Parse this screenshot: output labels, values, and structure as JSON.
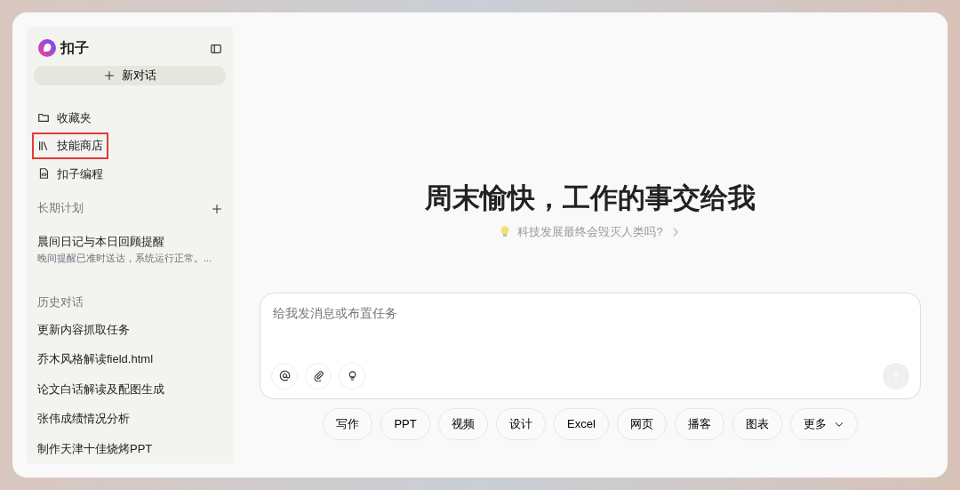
{
  "app": {
    "name": "扣子"
  },
  "new_chat_button": {
    "label": "新对话"
  },
  "nav_items": [
    {
      "label": "收藏夹",
      "kind": "folder",
      "highlighted": false
    },
    {
      "label": "技能商店",
      "kind": "store",
      "highlighted": true
    },
    {
      "label": "扣子编程",
      "kind": "code",
      "highlighted": false
    }
  ],
  "plans": {
    "heading": "长期计划",
    "items": [
      {
        "title": "晨间日记与本日回顾提醒",
        "subtitle": "晚间提醒已准时送达，系统运行正常。..."
      }
    ]
  },
  "history": {
    "heading": "历史对话",
    "items": [
      {
        "label": "更新内容抓取任务"
      },
      {
        "label": "乔木风格解读field.html"
      },
      {
        "label": "论文白话解读及配图生成"
      },
      {
        "label": "张伟成绩情况分析"
      },
      {
        "label": "制作天津十佳烧烤PPT"
      }
    ]
  },
  "main": {
    "headline": "周末愉快，工作的事交给我",
    "suggestion": "科技发展最终会毁灭人类吗?",
    "input": {
      "placeholder": "给我发消息或布置任务",
      "send_disabled": true
    },
    "chips": [
      {
        "label": "写作",
        "dropdown": false
      },
      {
        "label": "PPT",
        "dropdown": false
      },
      {
        "label": "视频",
        "dropdown": false
      },
      {
        "label": "设计",
        "dropdown": false
      },
      {
        "label": "Excel",
        "dropdown": false
      },
      {
        "label": "网页",
        "dropdown": false
      },
      {
        "label": "播客",
        "dropdown": false
      },
      {
        "label": "图表",
        "dropdown": false
      },
      {
        "label": "更多",
        "dropdown": true
      }
    ]
  }
}
